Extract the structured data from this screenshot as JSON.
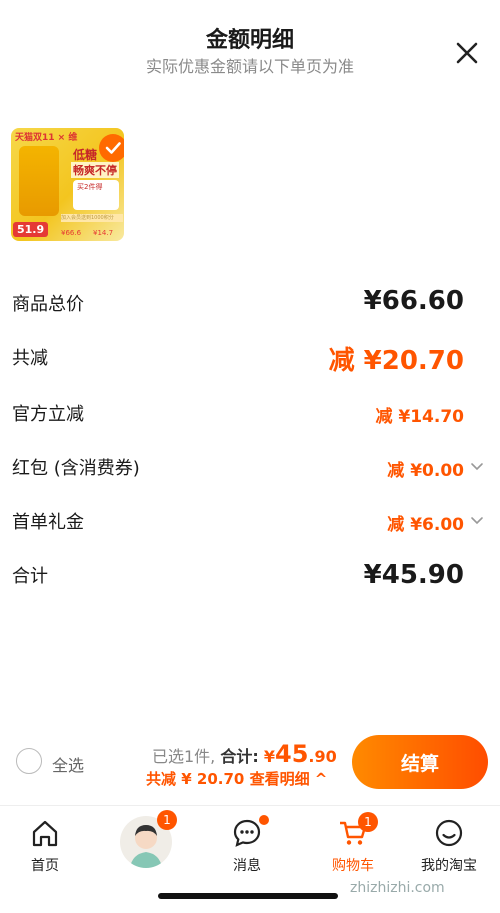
{
  "header": {
    "title": "金额明细",
    "subtitle": "实际优惠金额请以下单页为准",
    "close_icon": "close-icon"
  },
  "product": {
    "thumb_badge": "天猫双11 × 维",
    "thumb_text1": "低糖",
    "thumb_text2": "畅爽不停",
    "thumb_card": "买2件得",
    "thumb_strip": "加入会员送到1000积分",
    "thumb_price": "51.9",
    "thumb_small1": "¥66.6",
    "thumb_small2": "¥14.7",
    "selected_icon": "check-circle-icon"
  },
  "breakdown": [
    {
      "label": "商品总价",
      "value": "¥66.60",
      "color": "#1a1a1a"
    },
    {
      "label": "共减",
      "value": "减 ¥20.70",
      "color": "#ff5500"
    },
    {
      "label": "官方立减",
      "value": "减 ¥14.70",
      "color": "#ff5500"
    },
    {
      "label": "红包 (含消费券)",
      "value": "减 ¥0.00",
      "color": "#ff5500",
      "expandable": true
    },
    {
      "label": "首单礼金",
      "value": "减 ¥6.00",
      "color": "#ff5500",
      "expandable": true
    },
    {
      "label": "合计",
      "value": "¥45.90",
      "color": "#1a1a1a"
    }
  ],
  "bottom_bar": {
    "select_all": "全选",
    "selected_count": "已选1件,",
    "total_label": "合计:",
    "total_currency": "¥",
    "total_int": "45",
    "total_dec": ".90",
    "discount_text": "共减 ¥ 20.70",
    "detail_link": "查看明细 ^",
    "checkout": "结算"
  },
  "tabbar": {
    "home": "首页",
    "messages": "消息",
    "cart": "购物车",
    "mine": "我的淘宝",
    "avatar_badge": "1",
    "cart_badge": "1"
  },
  "watermark": "zhizhizhi.com",
  "colors": {
    "accent": "#ff5500",
    "checkout_gradient_start": "#ff8a00",
    "checkout_gradient_end": "#ff4d00"
  }
}
